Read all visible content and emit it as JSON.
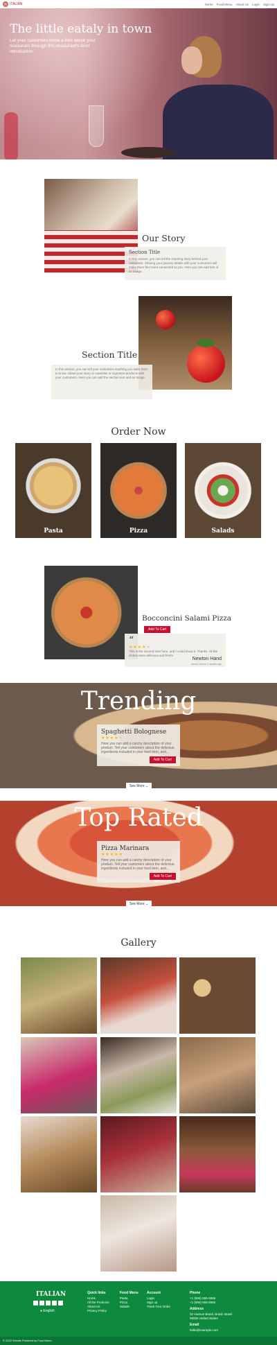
{
  "nav": {
    "brand": "ITALIAN",
    "links": [
      "Home",
      "Food Menu",
      "About Us",
      "Login",
      "Sign Up"
    ]
  },
  "hero": {
    "title": "The little eataly in town",
    "subtitle": "Let your customers know a little about your restaurant through this restaurant's brief introduction"
  },
  "story": {
    "title": "Our Story",
    "card_title": "Section Title",
    "card_text": "In this section, you can tell the inspiring story behind your restaurant. Sharing your journey details with your customers will make them feel more connected to you. Here you can add text of an image."
  },
  "section2": {
    "title": "Section Title",
    "card_text": "In this section, you can tell your customers anything you want them to know. Share your story or expertise or signature products with your customers. Here you can add the section text and an image."
  },
  "order": {
    "title": "Order Now",
    "tiles": [
      "Pasta",
      "Pizza",
      "Salads"
    ]
  },
  "featured": {
    "dish": "Bocconcini Salami Pizza",
    "add_to_cart": "Add To Cart",
    "review": "This is the second time here, and I could know it. Thanks. All the dishes were delicious and fresh!",
    "rating": 4,
    "reviewer": "Newton Hand",
    "reviewer_date": "Jenna Greeve 3 months ago"
  },
  "trending": {
    "title": "Trending",
    "dish": "Spaghetti Bolognese",
    "rating": 4,
    "text": "Here you can add a catchy description of your product. Tell your customers about the delicious ingredients included in your food item, and...",
    "add_to_cart": "Add To Cart",
    "see_more": "See More"
  },
  "top_rated": {
    "title": "Top Rated",
    "dish": "Pizza Marinara",
    "rating": 5,
    "text": "Here you can add a catchy description of your product. Tell your customers about the delicious ingredients included in your food item, and...",
    "add_to_cart": "Add To Cart",
    "see_more": "See More"
  },
  "gallery": {
    "title": "Gallery"
  },
  "footer": {
    "brand": "ITALIAN",
    "language": "English",
    "quick_links": {
      "title": "Quick links",
      "items": [
        "Home",
        "All the Products",
        "About Us",
        "Privacy Policy"
      ]
    },
    "food_menu": {
      "title": "Food Menu",
      "items": [
        "Pasta",
        "Pizza",
        "Salads"
      ]
    },
    "account": {
      "title": "Account",
      "items": [
        "Login",
        "Sign up",
        "Track Your Order"
      ]
    },
    "phone": {
      "title": "Phone",
      "items": [
        "+1 (555) 555-5555",
        "+1 (555) 555-5555"
      ]
    },
    "address": {
      "title": "Address",
      "items": [
        "32 Avenue Brasil, Brasil, Brasil",
        "00000 United States"
      ]
    },
    "email": {
      "title": "Email",
      "items": [
        "hello@example.com"
      ]
    },
    "copyright": "© 2022 Wixsite   Powered by Food Menu"
  },
  "colors": {
    "accent": "#c8102e",
    "footer": "#0d8a3e",
    "stars": "#f5b800"
  }
}
